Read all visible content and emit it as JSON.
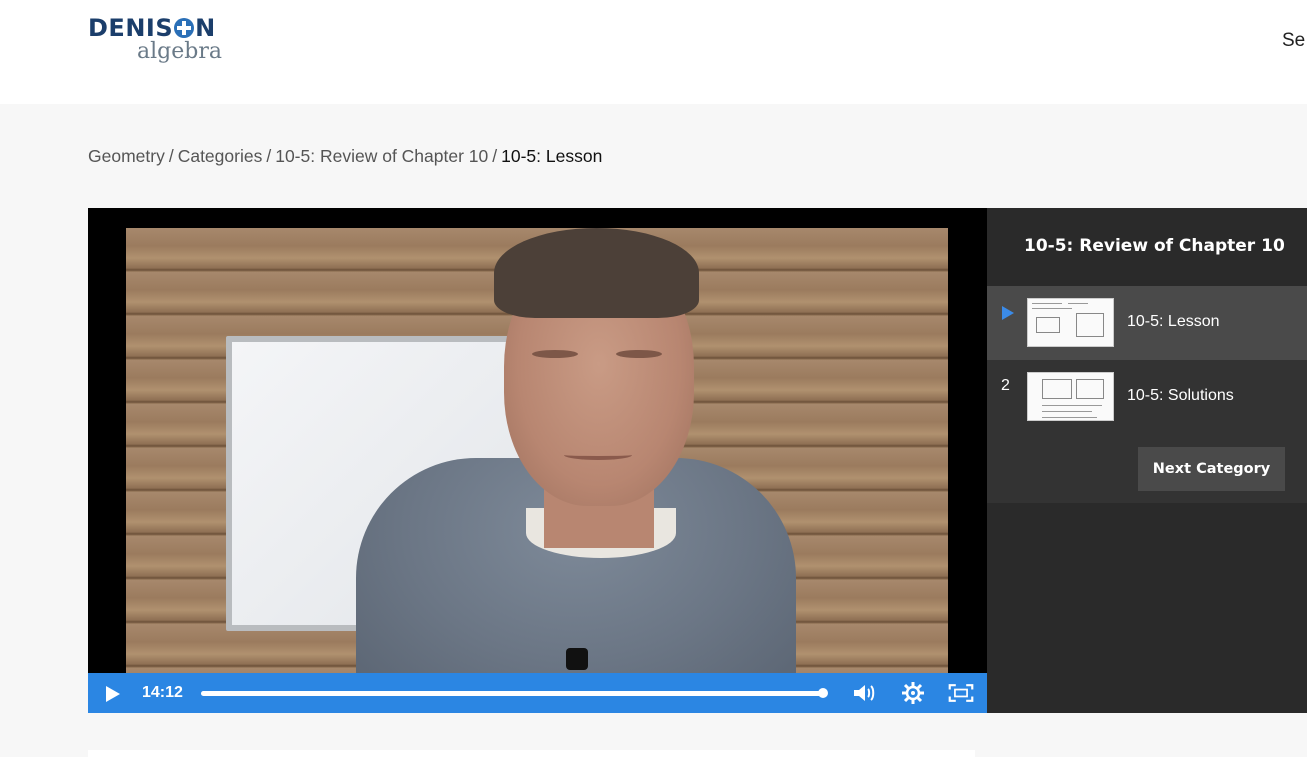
{
  "header": {
    "logo_top": "DENIS",
    "logo_top_end": "N",
    "logo_bottom": "algebra",
    "right_text": "Se"
  },
  "breadcrumb": {
    "items": [
      "Geometry",
      "Categories",
      "10-5: Review of Chapter 10"
    ],
    "separator": "/",
    "current": "10-5: Lesson"
  },
  "player": {
    "time": "14:12",
    "progress_fraction": 1.0,
    "accent_color": "#2b86e3",
    "icons": [
      "play-icon",
      "volume-icon",
      "settings-gear-icon",
      "fullscreen-icon"
    ]
  },
  "sidebar": {
    "title": "10-5: Review of Chapter 10",
    "items": [
      {
        "index": "",
        "label": "10-5: Lesson",
        "active": true
      },
      {
        "index": "2",
        "label": "10-5: Solutions",
        "active": false
      }
    ],
    "next_button": "Next Category"
  }
}
